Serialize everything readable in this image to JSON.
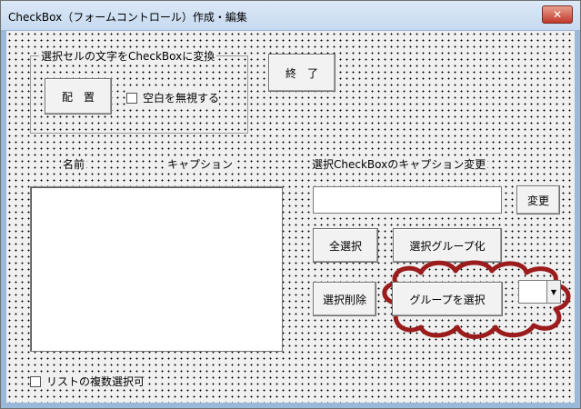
{
  "window": {
    "title": "CheckBox（フォームコントロール）作成・編集",
    "close_glyph": "✕"
  },
  "frame": {
    "label": "選択セルの文字をCheckBoxに変換"
  },
  "buttons": {
    "place": "配　置",
    "exit": "終　了",
    "change": "変更",
    "select_all": "全選択",
    "group_selected": "選択グループ化",
    "delete_selected": "選択削除",
    "select_group": "グループを選択"
  },
  "checkboxes": {
    "ignore_blank": "空白を無視する",
    "multi_select": "リストの複数選択可"
  },
  "list_headers": {
    "name": "名前",
    "caption": "キャプション"
  },
  "caption_change": {
    "label": "選択CheckBoxのキャプション変更",
    "value": ""
  },
  "combo": {
    "value": "",
    "arrow_glyph": "▼"
  },
  "colors": {
    "annotation": "#9b1c1c",
    "accent": "#c0392b"
  },
  "icons": {
    "close": "close-icon",
    "dropdown": "chevron-down-icon",
    "annotation": "cloud-callout"
  }
}
